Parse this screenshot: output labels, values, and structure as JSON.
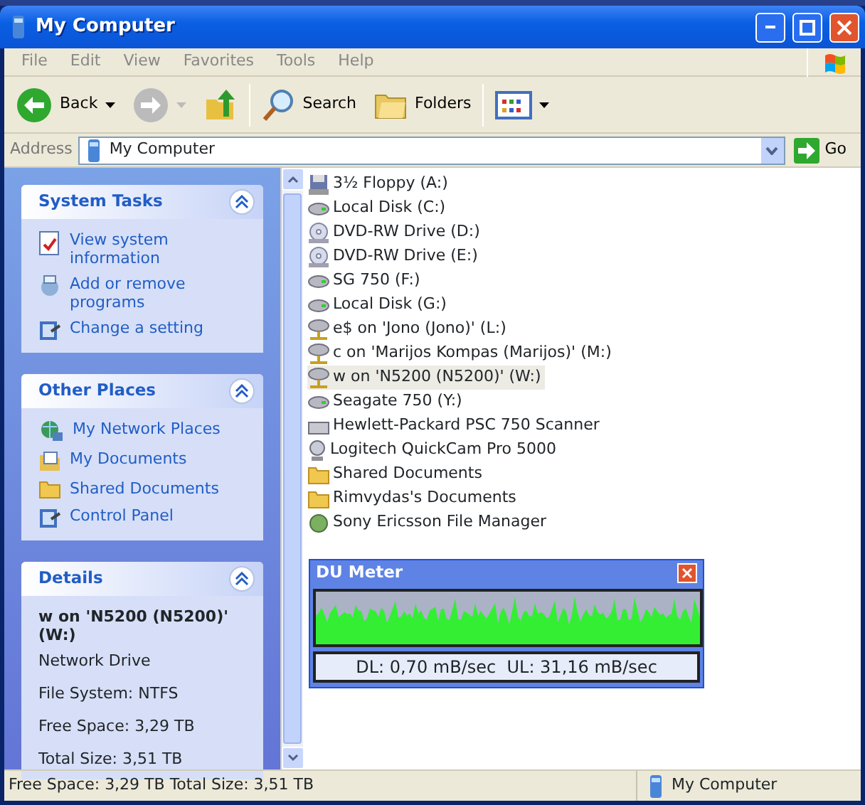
{
  "window": {
    "title": "My Computer"
  },
  "menu": [
    "File",
    "Edit",
    "View",
    "Favorites",
    "Tools",
    "Help"
  ],
  "toolbar": [
    {
      "kind": "back",
      "label": "Back",
      "disabled": false
    },
    {
      "kind": "forward",
      "disabled": true
    },
    {
      "kind": "up",
      "disabled": false
    },
    {
      "kind": "search",
      "label": "Search",
      "disabled": false
    },
    {
      "kind": "folders",
      "label": "Folders",
      "disabled": false
    },
    {
      "kind": "views",
      "disabled": false
    }
  ],
  "address": {
    "label": "Address",
    "value": "My Computer",
    "go": "Go"
  },
  "sidebar": [
    {
      "kind": "links",
      "title": "System Tasks",
      "expanded": true,
      "items": [
        {
          "label": "View system information",
          "kind": "sysinfo"
        },
        {
          "label": "Add or remove programs",
          "kind": "addremove"
        },
        {
          "label": "Change a setting",
          "kind": "setting"
        }
      ]
    },
    {
      "kind": "links",
      "title": "Other Places",
      "expanded": true,
      "items": [
        {
          "label": "My Network Places",
          "kind": "network"
        },
        {
          "label": "My Documents",
          "kind": "docs"
        },
        {
          "label": "Shared Documents",
          "kind": "folder"
        },
        {
          "label": "Control Panel",
          "kind": "setting"
        }
      ]
    },
    {
      "kind": "details",
      "title": "Details",
      "expanded": true,
      "name": "w on 'N5200 (N5200)' (W:)",
      "lines": [
        "Network Drive",
        "File System: NTFS",
        "Free Space: 3,29 TB",
        "Total Size: 3,51 TB"
      ]
    }
  ],
  "items": [
    {
      "label": "3½ Floppy (A:)",
      "kind": "floppy",
      "selected": false
    },
    {
      "label": "Local Disk (C:)",
      "kind": "disk",
      "selected": false
    },
    {
      "label": "DVD-RW Drive (D:)",
      "kind": "optical",
      "selected": false
    },
    {
      "label": "DVD-RW Drive (E:)",
      "kind": "optical",
      "selected": false
    },
    {
      "label": "SG 750 (F:)",
      "kind": "disk",
      "selected": false
    },
    {
      "label": "Local Disk (G:)",
      "kind": "disk",
      "selected": false
    },
    {
      "label": "e$ on 'Jono (Jono)' (L:)",
      "kind": "network",
      "selected": false
    },
    {
      "label": "c on 'Marijos Kompas (Marijos)' (M:)",
      "kind": "network",
      "selected": false
    },
    {
      "label": "w on 'N5200 (N5200)' (W:)",
      "kind": "network",
      "selected": true
    },
    {
      "label": "Seagate 750 (Y:)",
      "kind": "disk",
      "selected": false
    },
    {
      "label": "Hewlett-Packard PSC 750 Scanner",
      "kind": "scanner",
      "selected": false
    },
    {
      "label": "Logitech QuickCam Pro 5000",
      "kind": "camera",
      "selected": false
    },
    {
      "label": "Shared Documents",
      "kind": "folder",
      "selected": false
    },
    {
      "label": "Rimvydas's Documents",
      "kind": "folder",
      "selected": false
    },
    {
      "label": "Sony Ericsson File Manager",
      "kind": "app",
      "selected": false
    }
  ],
  "du_meter": {
    "title": "DU Meter",
    "reading": "DL: 0,70 mB/sec  UL: 31,16 mB/sec"
  },
  "status_bar": {
    "text": "Free Space: 3,29 TB Total Size: 3,51 TB",
    "zone": "My Computer"
  }
}
